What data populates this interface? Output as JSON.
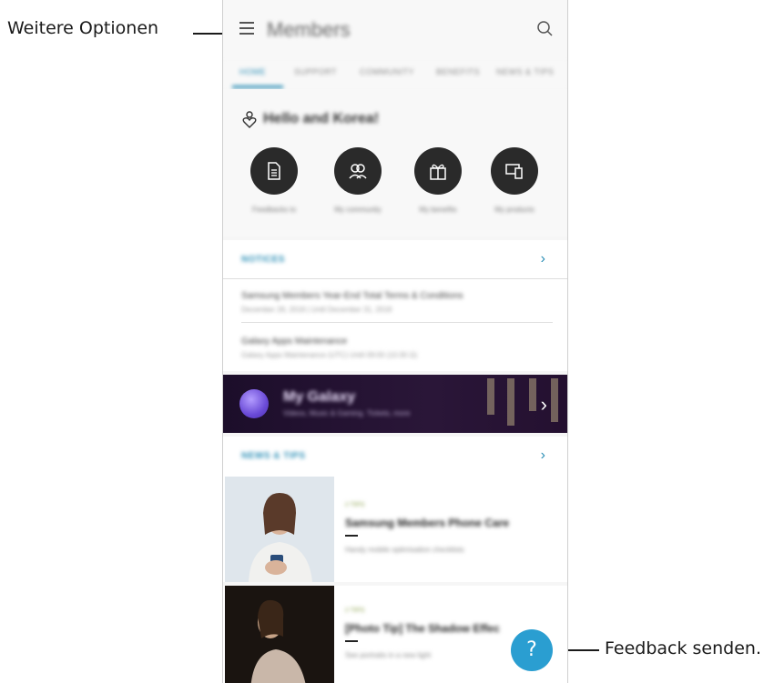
{
  "callouts": {
    "more_options": "Weitere Optionen",
    "send_feedback": "Feedback senden."
  },
  "app": {
    "title": "Members",
    "tabs": [
      "HOME",
      "SUPPORT",
      "COMMUNITY",
      "BENEFITS",
      "NEWS & TIPS"
    ],
    "active_tab": "HOME"
  },
  "welcome": {
    "greeting": "Hello and Korea!",
    "quick_actions": [
      "Feedbacks to",
      "My community",
      "My benefits",
      "My products"
    ]
  },
  "notices": {
    "title": "NOTICES",
    "items": [
      {
        "title": "Samsung Members Year-End Total Terms & Conditions",
        "subtitle": "December 28, 2018 | Until December 31, 2018"
      },
      {
        "title": "Galaxy Apps Maintenance",
        "subtitle": "Galaxy Apps Maintenance (UTC) Until 09:00 (10:30 Ω)"
      }
    ]
  },
  "banner": {
    "title": "My Galaxy",
    "subtitle": "Videos, Music & Gaming. Tickets, more"
  },
  "news": {
    "title": "NEWS & TIPS",
    "items": [
      {
        "category": "// TIPS",
        "title": "Samsung Members Phone Care",
        "subtitle": "Handy mobile optimisation checklists"
      },
      {
        "category": "// TIPS",
        "title": "[Photo Tip] The Shadow Effec",
        "subtitle": "See portraits in a new light"
      }
    ]
  },
  "fab": {
    "label": "?"
  },
  "colors": {
    "accent": "#2d8fb6",
    "fab": "#2a9ed1",
    "banner": "#2a1638"
  }
}
